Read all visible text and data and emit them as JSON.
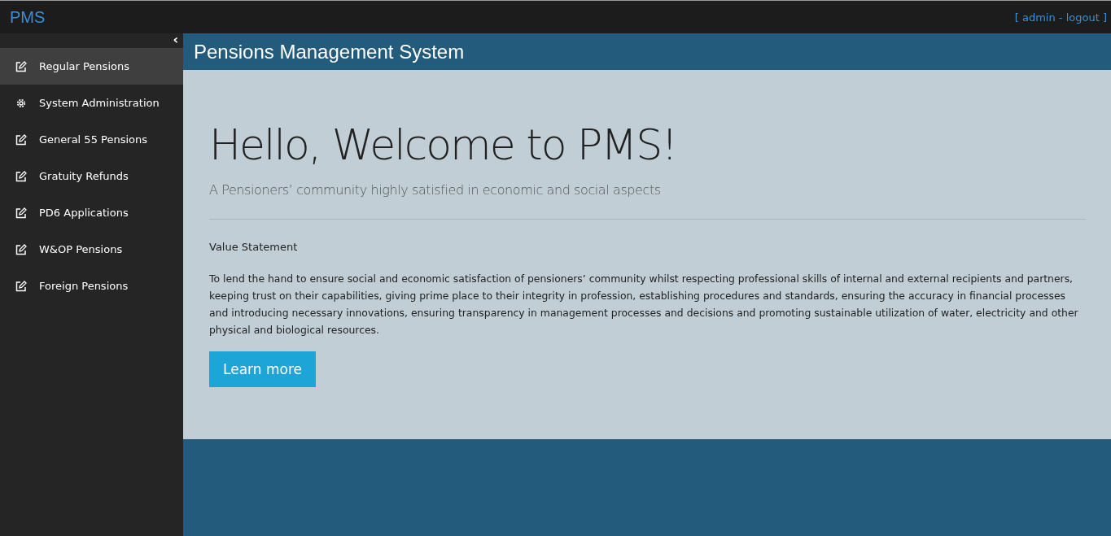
{
  "brand": "PMS",
  "user_links": "[ admin - logout ]",
  "sidebar": {
    "collapse_icon": "‹",
    "items": [
      {
        "label": "Regular Pensions",
        "kind": "edit",
        "selected": true
      },
      {
        "label": "System Administration",
        "kind": "gear",
        "selected": false
      },
      {
        "label": "General 55 Pensions",
        "kind": "edit",
        "selected": false
      },
      {
        "label": "Gratuity Refunds",
        "kind": "edit",
        "selected": false
      },
      {
        "label": "PD6 Applications",
        "kind": "edit",
        "selected": false
      },
      {
        "label": "W&OP Pensions",
        "kind": "edit",
        "selected": false
      },
      {
        "label": "Foreign Pensions",
        "kind": "edit",
        "selected": false
      }
    ]
  },
  "page_title": "Pensions Management System",
  "hero": {
    "heading": "Hello, Welcome to PMS!",
    "subheading": "A Pensioners’ community highly satisfied in economic and social aspects",
    "section_label": "Value Statement",
    "body": "To lend the hand to ensure social and economic satisfaction of pensioners’ community whilst respecting professional skills of internal and external recipients and partners, keeping trust on their capabilities, giving prime place to their integrity in profession, establishing procedures and standards, ensuring the accuracy in financial processes and introducing necessary innovations, ensuring transparency in management processes and decisions and promoting sustainable utilization of water, electricity and other physical and biological resources.",
    "button": "Learn more"
  }
}
